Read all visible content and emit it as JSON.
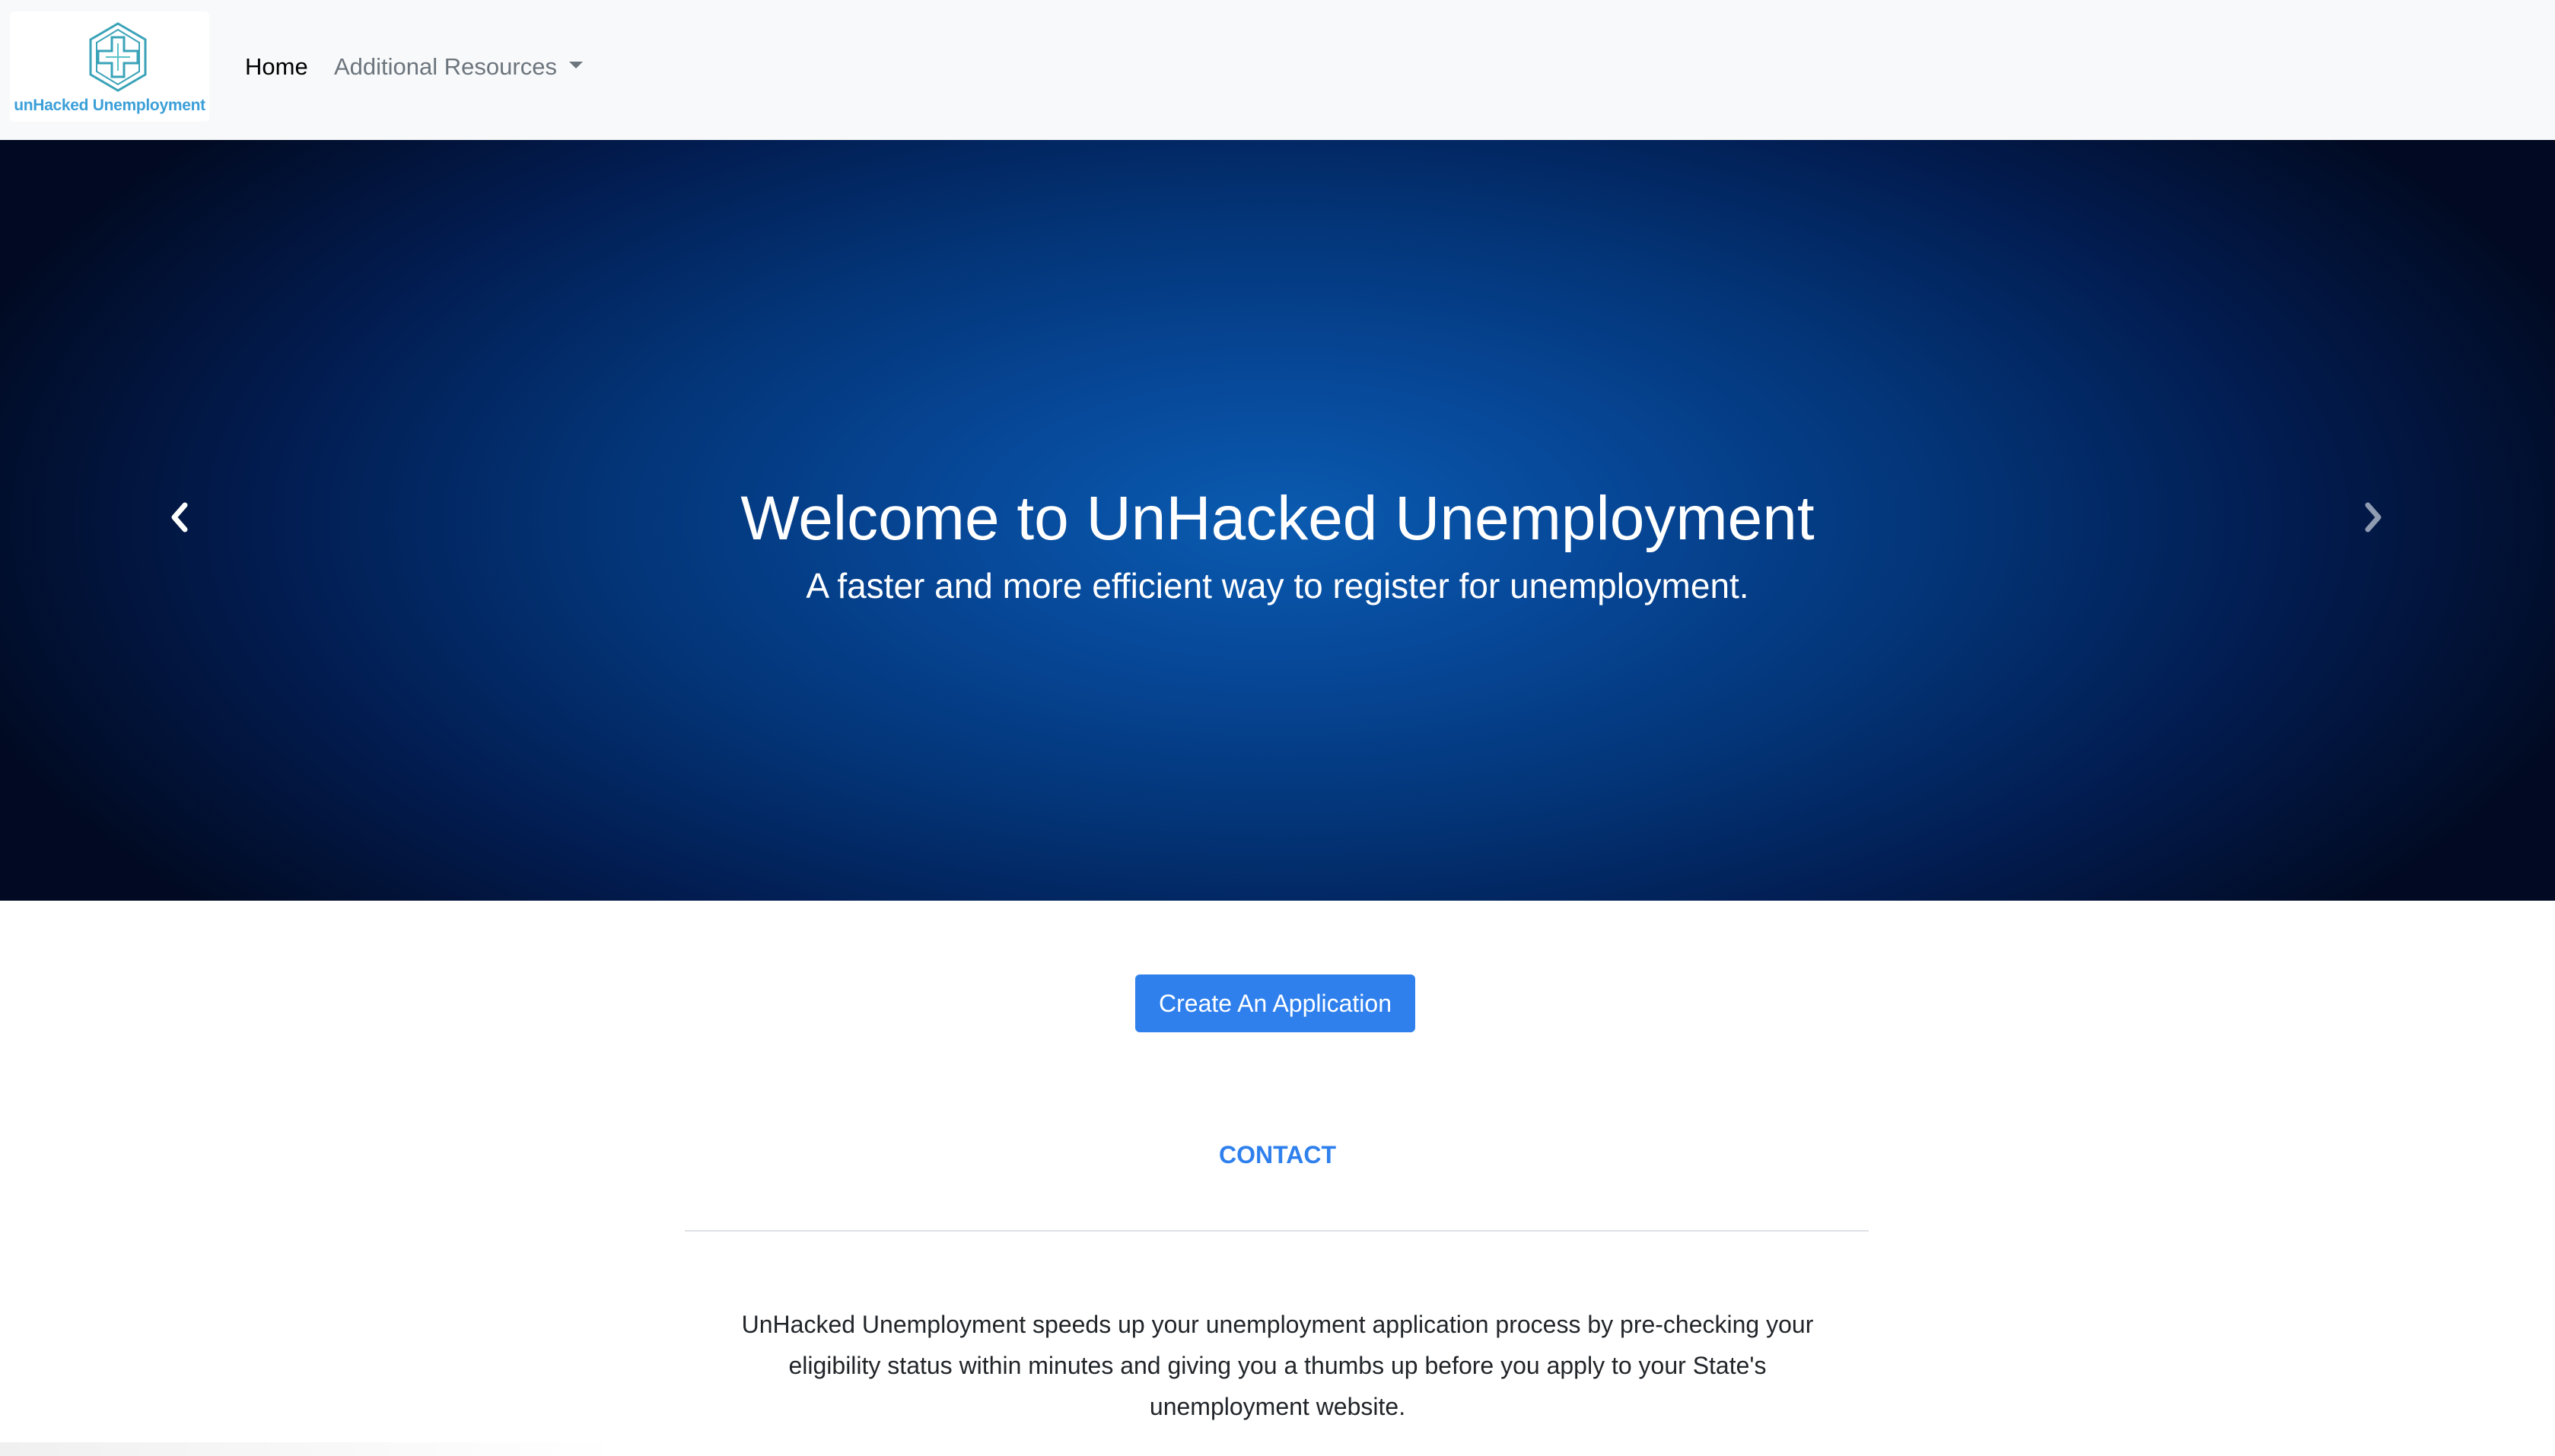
{
  "navbar": {
    "logo_text": "unHacked Unemployment",
    "links": {
      "home": "Home",
      "resources": "Additional Resources"
    },
    "icons": {
      "dropdown": "chevron-down-icon"
    }
  },
  "hero": {
    "title": "Welcome to UnHacked Unemployment",
    "subtitle": "A faster and more efficient way to register for unemployment.",
    "icons": {
      "prev": "chevron-left-icon",
      "next": "chevron-right-icon"
    }
  },
  "main": {
    "cta_label": "Create An Application",
    "contact_label": "CONTACT",
    "description": "UnHacked Unemployment speeds up your unemployment application process by pre-checking your eligibility status within minutes and giving you a thumbs up before you apply to your State's unemployment website."
  },
  "colors": {
    "primary": "#2f80ed",
    "hero_center": "#0a5bb0",
    "hero_edge": "#010a22",
    "navbar_bg": "#f8f9fa",
    "logo_accent": "#3aa3b8"
  }
}
